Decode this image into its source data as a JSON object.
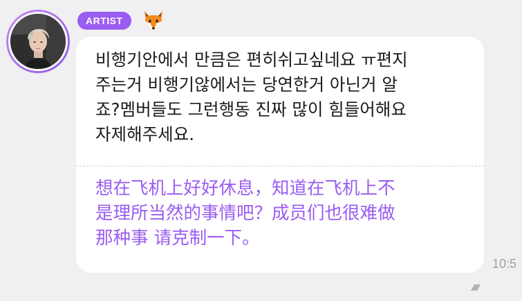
{
  "message": {
    "badge_label": "ARTIST",
    "badge_color": "#9a5cf1",
    "emoji": "fox-face",
    "korean_text": "비행기안에서 만큼은 편히쉬고싶네요 ㅠ편지\n주는거 비행기않에서는 당연한거 아닌거 알\n죠?멤버들도 그런행동 진짜 많이 힘들어해요\n자제해주세요.",
    "chinese_text": "想在飞机上好好休息，知道在飞机上不\n是理所当然的事情吧？成员们也很难做\n那种事 请克制一下。",
    "timestamp": "10:5",
    "translation_color": "#9a5cf1"
  },
  "watermark": "⁄⁄⁄⁄⁄⁄⁄⁄⁄"
}
